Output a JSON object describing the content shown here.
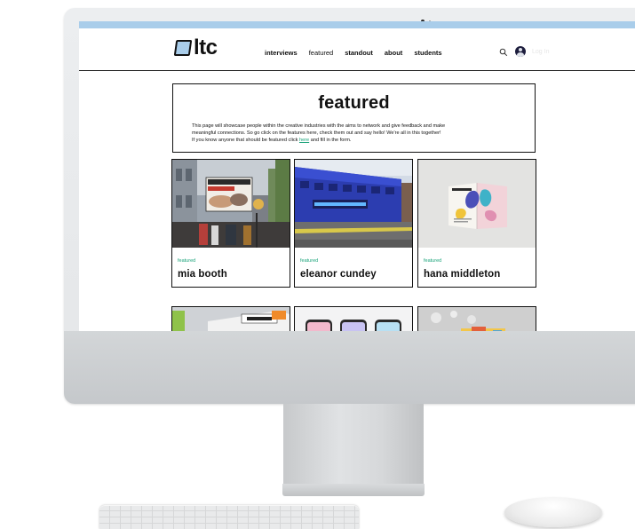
{
  "site": {
    "logo_text": "ltc",
    "login_label": "Log In"
  },
  "nav": {
    "items": [
      {
        "label": "interviews",
        "weight": "bold"
      },
      {
        "label": "featured",
        "weight": "plain"
      },
      {
        "label": "standout",
        "weight": "bold"
      },
      {
        "label": "about",
        "weight": "bold"
      },
      {
        "label": "students",
        "weight": "bold"
      }
    ]
  },
  "intro": {
    "title": "featured",
    "line1": "This page will showcase people within the creative industries with the aims to network and give feedback and make",
    "line2": "meaningful connections. So go click on the features here, check them out and say hello! We're all in this together!",
    "line3_pre": "If you know anyone that should be featured click ",
    "line3_link": "here",
    "line3_post": " and fill in the form."
  },
  "cards": [
    {
      "tag": "featured",
      "name": "mia booth"
    },
    {
      "tag": "featured",
      "name": "eleanor cundey"
    },
    {
      "tag": "featured",
      "name": "hana middleton"
    }
  ],
  "colors": {
    "accent_blue": "#a9cdea",
    "accent_green": "#1aa37a",
    "ink": "#111111"
  },
  "icons": {
    "search": "search-icon",
    "account": "avatar-icon"
  }
}
